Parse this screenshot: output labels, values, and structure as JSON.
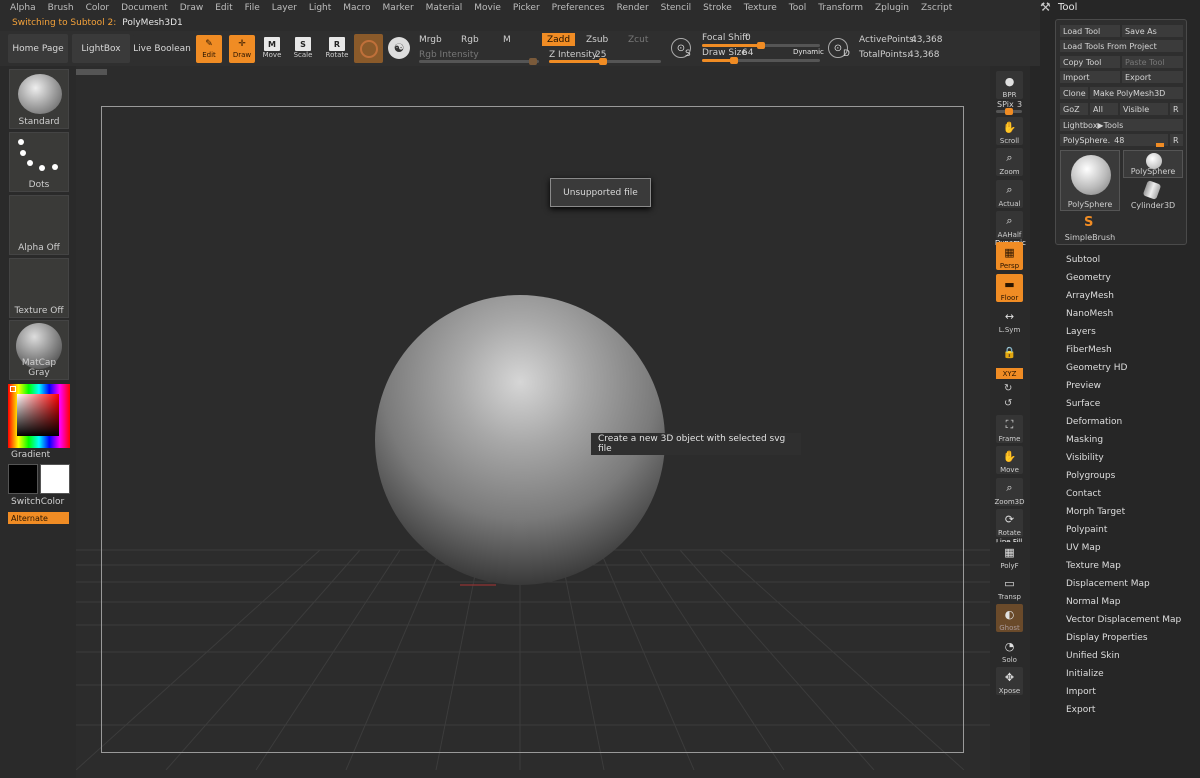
{
  "menubar": [
    "Alpha",
    "Brush",
    "Color",
    "Document",
    "Draw",
    "Edit",
    "File",
    "Layer",
    "Light",
    "Macro",
    "Marker",
    "Material",
    "Movie",
    "Picker",
    "Preferences",
    "Render",
    "Stencil",
    "Stroke",
    "Texture",
    "Tool",
    "Transform",
    "Zplugin",
    "Zscript"
  ],
  "status": {
    "label": "Switching to Subtool 2:",
    "value": "PolyMesh3D1"
  },
  "toolbar": {
    "home": "Home Page",
    "lightbox": "LightBox",
    "live_boolean": "Live Boolean",
    "edit": "Edit",
    "draw": "Draw",
    "move": "Move",
    "scale": "Scale",
    "rotate": "Rotate",
    "mrgb": "Mrgb",
    "rgb": "Rgb",
    "m": "M",
    "zadd": "Zadd",
    "zsub": "Zsub",
    "zcut": "Zcut",
    "rgb_intensity": "Rgb Intensity",
    "z_intensity_label": "Z Intensity",
    "z_intensity": "25",
    "focal_shift_label": "Focal Shift",
    "focal_shift": "0",
    "draw_size_label": "Draw Size",
    "draw_size": "64",
    "dynamic": "Dynamic",
    "s_key": "S",
    "d_key": "D",
    "active_points_label": "ActivePoints:",
    "active_points": "43,368",
    "total_points_label": "TotalPoints:",
    "total_points": "43,368"
  },
  "leftshelf": {
    "standard": "Standard",
    "dots": "Dots",
    "alpha": "Alpha Off",
    "texture": "Texture Off",
    "matcap": "MatCap Gray",
    "gradient": "Gradient",
    "switchcolor": "SwitchColor",
    "alternate": "Alternate"
  },
  "canvas": {
    "popup": "Unsupported file",
    "tooltip": "Create a new 3D object with selected svg file"
  },
  "rightshelf": {
    "bpr": "BPR",
    "spix_label": "SPix",
    "spix": "3",
    "scroll": "Scroll",
    "zoom": "Zoom",
    "actual": "Actual",
    "aahalf": "AAHalf",
    "dynamic": "Dynamic",
    "persp": "Persp",
    "floor": "Floor",
    "lsym": "L.Sym",
    "xyz": "XYZ",
    "frame": "Frame",
    "move": "Move",
    "zoom3d": "Zoom3D",
    "rotate": "Rotate",
    "linefill": "Line Fill",
    "polyf": "PolyF",
    "transp": "Transp",
    "ghost": "Ghost",
    "solo": "Solo",
    "xpose": "Xpose"
  },
  "tool": {
    "title": "Tool",
    "buttons": {
      "load": "Load Tool",
      "save": "Save As",
      "load_project": "Load Tools From Project",
      "copy": "Copy Tool",
      "paste": "Paste Tool",
      "import": "Import",
      "export": "Export",
      "clone": "Clone",
      "make": "Make PolyMesh3D",
      "goz": "GoZ",
      "all": "All",
      "visible": "Visible",
      "r": "R",
      "lightbox": "Lightbox▶Tools",
      "polysphere": "PolySphere.",
      "polysphere_val": "48",
      "r2": "R"
    },
    "thumbs": {
      "main": "PolySphere",
      "small": "PolySphere",
      "cyl": "Cylinder3D",
      "brush": "SimpleBrush"
    },
    "sections": [
      "Subtool",
      "Geometry",
      "ArrayMesh",
      "NanoMesh",
      "Layers",
      "FiberMesh",
      "Geometry HD",
      "Preview",
      "Surface",
      "Deformation",
      "Masking",
      "Visibility",
      "Polygroups",
      "Contact",
      "Morph Target",
      "Polypaint",
      "UV Map",
      "Texture Map",
      "Displacement Map",
      "Normal Map",
      "Vector Displacement Map",
      "Display Properties",
      "Unified Skin",
      "Initialize",
      "Import",
      "Export"
    ]
  },
  "colors": {
    "accent": "#f08c24",
    "panel": "#2e2e2e",
    "canvas": "#2c2c2c"
  }
}
